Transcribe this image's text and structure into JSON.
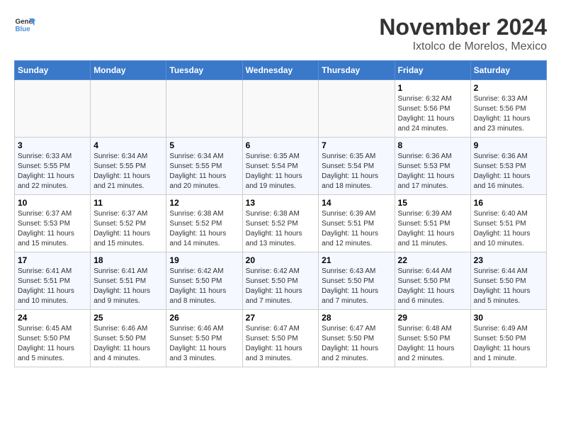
{
  "logo": {
    "line1": "General",
    "line2": "Blue"
  },
  "title": "November 2024",
  "location": "Ixtolco de Morelos, Mexico",
  "weekdays": [
    "Sunday",
    "Monday",
    "Tuesday",
    "Wednesday",
    "Thursday",
    "Friday",
    "Saturday"
  ],
  "weeks": [
    [
      {
        "day": "",
        "info": ""
      },
      {
        "day": "",
        "info": ""
      },
      {
        "day": "",
        "info": ""
      },
      {
        "day": "",
        "info": ""
      },
      {
        "day": "",
        "info": ""
      },
      {
        "day": "1",
        "info": "Sunrise: 6:32 AM\nSunset: 5:56 PM\nDaylight: 11 hours and 24 minutes."
      },
      {
        "day": "2",
        "info": "Sunrise: 6:33 AM\nSunset: 5:56 PM\nDaylight: 11 hours and 23 minutes."
      }
    ],
    [
      {
        "day": "3",
        "info": "Sunrise: 6:33 AM\nSunset: 5:55 PM\nDaylight: 11 hours and 22 minutes."
      },
      {
        "day": "4",
        "info": "Sunrise: 6:34 AM\nSunset: 5:55 PM\nDaylight: 11 hours and 21 minutes."
      },
      {
        "day": "5",
        "info": "Sunrise: 6:34 AM\nSunset: 5:55 PM\nDaylight: 11 hours and 20 minutes."
      },
      {
        "day": "6",
        "info": "Sunrise: 6:35 AM\nSunset: 5:54 PM\nDaylight: 11 hours and 19 minutes."
      },
      {
        "day": "7",
        "info": "Sunrise: 6:35 AM\nSunset: 5:54 PM\nDaylight: 11 hours and 18 minutes."
      },
      {
        "day": "8",
        "info": "Sunrise: 6:36 AM\nSunset: 5:53 PM\nDaylight: 11 hours and 17 minutes."
      },
      {
        "day": "9",
        "info": "Sunrise: 6:36 AM\nSunset: 5:53 PM\nDaylight: 11 hours and 16 minutes."
      }
    ],
    [
      {
        "day": "10",
        "info": "Sunrise: 6:37 AM\nSunset: 5:53 PM\nDaylight: 11 hours and 15 minutes."
      },
      {
        "day": "11",
        "info": "Sunrise: 6:37 AM\nSunset: 5:52 PM\nDaylight: 11 hours and 15 minutes."
      },
      {
        "day": "12",
        "info": "Sunrise: 6:38 AM\nSunset: 5:52 PM\nDaylight: 11 hours and 14 minutes."
      },
      {
        "day": "13",
        "info": "Sunrise: 6:38 AM\nSunset: 5:52 PM\nDaylight: 11 hours and 13 minutes."
      },
      {
        "day": "14",
        "info": "Sunrise: 6:39 AM\nSunset: 5:51 PM\nDaylight: 11 hours and 12 minutes."
      },
      {
        "day": "15",
        "info": "Sunrise: 6:39 AM\nSunset: 5:51 PM\nDaylight: 11 hours and 11 minutes."
      },
      {
        "day": "16",
        "info": "Sunrise: 6:40 AM\nSunset: 5:51 PM\nDaylight: 11 hours and 10 minutes."
      }
    ],
    [
      {
        "day": "17",
        "info": "Sunrise: 6:41 AM\nSunset: 5:51 PM\nDaylight: 11 hours and 10 minutes."
      },
      {
        "day": "18",
        "info": "Sunrise: 6:41 AM\nSunset: 5:51 PM\nDaylight: 11 hours and 9 minutes."
      },
      {
        "day": "19",
        "info": "Sunrise: 6:42 AM\nSunset: 5:50 PM\nDaylight: 11 hours and 8 minutes."
      },
      {
        "day": "20",
        "info": "Sunrise: 6:42 AM\nSunset: 5:50 PM\nDaylight: 11 hours and 7 minutes."
      },
      {
        "day": "21",
        "info": "Sunrise: 6:43 AM\nSunset: 5:50 PM\nDaylight: 11 hours and 7 minutes."
      },
      {
        "day": "22",
        "info": "Sunrise: 6:44 AM\nSunset: 5:50 PM\nDaylight: 11 hours and 6 minutes."
      },
      {
        "day": "23",
        "info": "Sunrise: 6:44 AM\nSunset: 5:50 PM\nDaylight: 11 hours and 5 minutes."
      }
    ],
    [
      {
        "day": "24",
        "info": "Sunrise: 6:45 AM\nSunset: 5:50 PM\nDaylight: 11 hours and 5 minutes."
      },
      {
        "day": "25",
        "info": "Sunrise: 6:46 AM\nSunset: 5:50 PM\nDaylight: 11 hours and 4 minutes."
      },
      {
        "day": "26",
        "info": "Sunrise: 6:46 AM\nSunset: 5:50 PM\nDaylight: 11 hours and 3 minutes."
      },
      {
        "day": "27",
        "info": "Sunrise: 6:47 AM\nSunset: 5:50 PM\nDaylight: 11 hours and 3 minutes."
      },
      {
        "day": "28",
        "info": "Sunrise: 6:47 AM\nSunset: 5:50 PM\nDaylight: 11 hours and 2 minutes."
      },
      {
        "day": "29",
        "info": "Sunrise: 6:48 AM\nSunset: 5:50 PM\nDaylight: 11 hours and 2 minutes."
      },
      {
        "day": "30",
        "info": "Sunrise: 6:49 AM\nSunset: 5:50 PM\nDaylight: 11 hours and 1 minute."
      }
    ]
  ]
}
